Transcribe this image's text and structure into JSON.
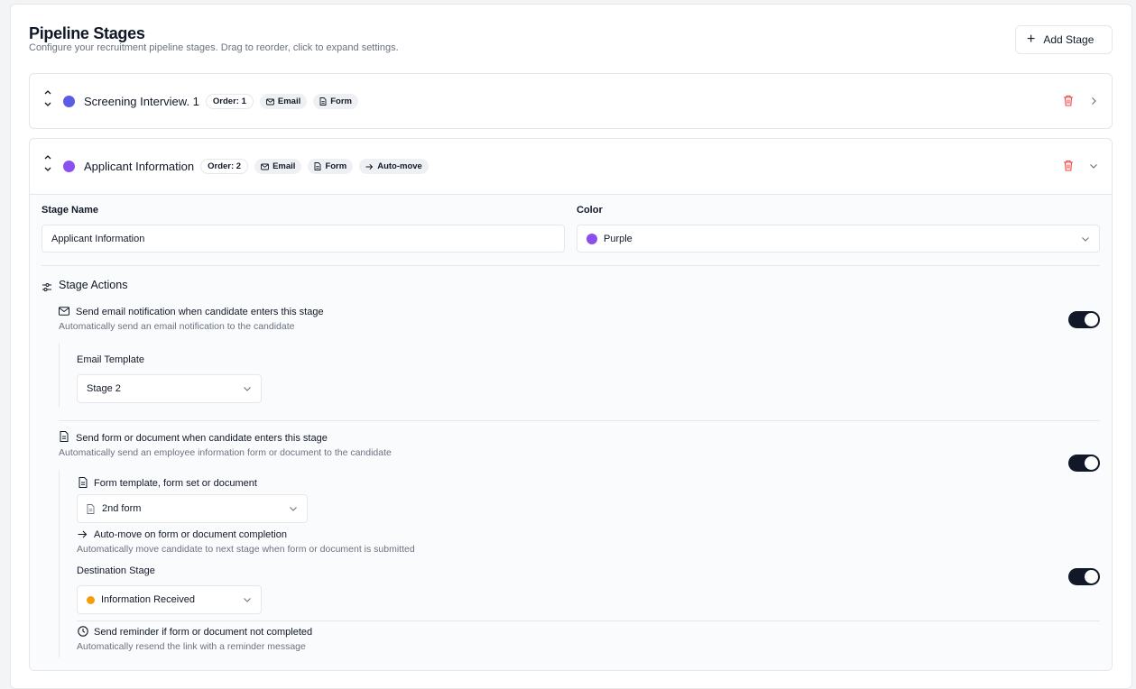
{
  "page": {
    "title": "Pipeline Stages",
    "subtitle": "Configure your recruitment pipeline stages. Drag to reorder, click to expand settings.",
    "add_stage_label": "Add Stage"
  },
  "stages": [
    {
      "name": "Screening Interview. 1",
      "color": "#5b5be6",
      "order_badge": "Order: 1",
      "badges": [
        "Email",
        "Form"
      ],
      "expanded": false
    },
    {
      "name": "Applicant Information",
      "color": "#8b4ff0",
      "order_badge": "Order: 2",
      "badges": [
        "Email",
        "Form",
        "Auto-move"
      ],
      "expanded": true
    }
  ],
  "editor": {
    "stage_name_label": "Stage Name",
    "stage_name_value": "Applicant Information",
    "color_label": "Color",
    "color_value": "Purple",
    "color_hex": "#8b4ff0",
    "actions_title": "Stage Actions",
    "email_action": {
      "title": "Send email notification when candidate enters this stage",
      "desc": "Automatically send an email notification to the candidate",
      "enabled": true,
      "template_label": "Email Template",
      "template_value": "Stage 2"
    },
    "form_action": {
      "title": "Send form or document when candidate enters this stage",
      "desc": "Automatically send an employee information form or document to the candidate",
      "enabled": true,
      "template_label": "Form template, form set or document",
      "template_value": "2nd form"
    },
    "auto_move": {
      "title": "Auto-move on form or document completion",
      "desc": "Automatically move candidate to next stage when form or document is submitted",
      "enabled": true,
      "destination_label": "Destination Stage",
      "destination_value": "Information Received",
      "destination_color": "#f59e0b"
    },
    "reminder": {
      "title": "Send reminder if form or document not completed",
      "desc": "Automatically resend the link with a reminder message",
      "enabled": false
    }
  },
  "colors": {
    "danger": "#ef4444",
    "toggle_on": "#111827",
    "toggle_off": "#e5e7eb",
    "muted_text": "#6b7280"
  }
}
